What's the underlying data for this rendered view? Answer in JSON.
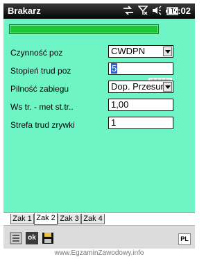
{
  "titlebar": {
    "app_title": "Brakarz",
    "time": "12:02",
    "icons": [
      "sync-arrows-icon",
      "signal-off-icon",
      "speaker-icon",
      "battery-icon"
    ]
  },
  "form": {
    "rows": [
      {
        "label": "Czynność poz",
        "value": "CWDPN",
        "type": "combo"
      },
      {
        "label": "Stopień trud poz",
        "value": "5",
        "type": "text-selected"
      },
      {
        "label": "Pilność zabiegu",
        "value": "Dop. Przesun",
        "type": "combo"
      },
      {
        "label": "Ws tr. - met st.tr..",
        "value": "1,00",
        "type": "text"
      },
      {
        "label": "Strefa trud zrywki",
        "value": "1",
        "type": "text"
      }
    ]
  },
  "tabs": [
    {
      "label": "Zak 1",
      "active": false
    },
    {
      "label": "Zak 2",
      "active": true
    },
    {
      "label": "Zak 3",
      "active": false
    },
    {
      "label": "Zak 4",
      "active": false
    }
  ],
  "bottombar": {
    "ok_label": "ok",
    "pl_label": "PL"
  },
  "watermark": "www.EgzaminZawodowy.info",
  "colors": {
    "background": "#6ff4c6",
    "banner": "#1fc43a",
    "selection": "#2d63d8"
  }
}
